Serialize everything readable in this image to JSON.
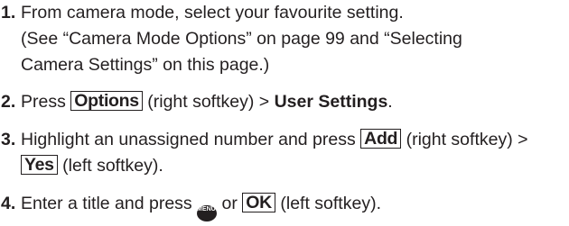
{
  "steps": [
    {
      "number": "1.",
      "lines": [
        "From camera mode, select your favourite setting.",
        "(See “Camera Mode Options” on page 99 and “Selecting",
        "Camera Settings” on this page.)"
      ]
    },
    {
      "number": "2.",
      "pre": "Press ",
      "key_options": "Options",
      "mid": " (right softkey) > ",
      "bold_target": "User Settings",
      "end": "."
    },
    {
      "number": "3.",
      "line1_pre": "Highlight an unassigned number and press ",
      "key_add": "Add",
      "line1_post": " (right softkey) >",
      "key_yes": "Yes",
      "line2_post": " (left softkey)."
    },
    {
      "number": "4.",
      "pre": "Enter a title and press ",
      "menu_icon_label": "MENU OK",
      "mid": " or ",
      "key_ok": "OK",
      "end": " (left softkey)."
    }
  ]
}
